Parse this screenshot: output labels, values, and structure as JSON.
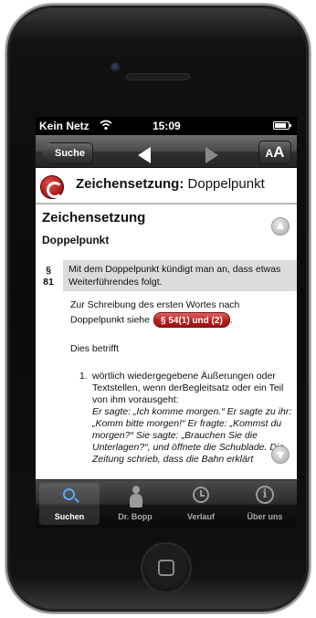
{
  "status_bar": {
    "carrier": "Kein Netz",
    "time": "15:09"
  },
  "nav": {
    "back_label": "Suche",
    "font_small": "A",
    "font_big": "A"
  },
  "title": {
    "bold": "Zeichensetzung:",
    "rest": " Doppelpunkt"
  },
  "content": {
    "heading": "Zeichensetzung",
    "subheading": "Doppelpunkt",
    "paragraph_mark": "§",
    "paragraph_number": "81",
    "paragraph_text": "Mit dem Doppelpunkt kündigt man an, dass etwas Weiterführendes folgt.",
    "reference_text": "Zur Schreibung des ersten Wortes nach Doppelpunkt siehe",
    "reference_link": "§ 54(1) und (2)",
    "reference_suffix": ".",
    "intro": "Dies betrifft",
    "list_number": "1.",
    "list_text": "wörtlich wiedergegebene Äußerungen oder Textstellen, wenn derBegleitsatz oder ein Teil von ihm vorausgeht:",
    "list_quote": "Er sagte: „Ich komme morgen.“ Er sagte zu ihr: „Komm bitte morgen!“ Er fragte: „Kommst du morgen?“ Sie sagte: „Brauchen Sie die Unterlagen?“, und öffnete die Schublade. Die Zeitung schrieb, dass die Bahn erklärt"
  },
  "tabs": [
    {
      "label": "Suchen",
      "icon": "search-icon",
      "active": true
    },
    {
      "label": "Dr. Bopp",
      "icon": "person-icon",
      "active": false
    },
    {
      "label": "Verlauf",
      "icon": "clock-icon",
      "active": false
    },
    {
      "label": "Über uns",
      "icon": "info-icon",
      "active": false
    }
  ],
  "colors": {
    "accent_red": "#b81f1f",
    "search_blue": "#58a8ff",
    "nav_dark": "#2b2b2b"
  }
}
